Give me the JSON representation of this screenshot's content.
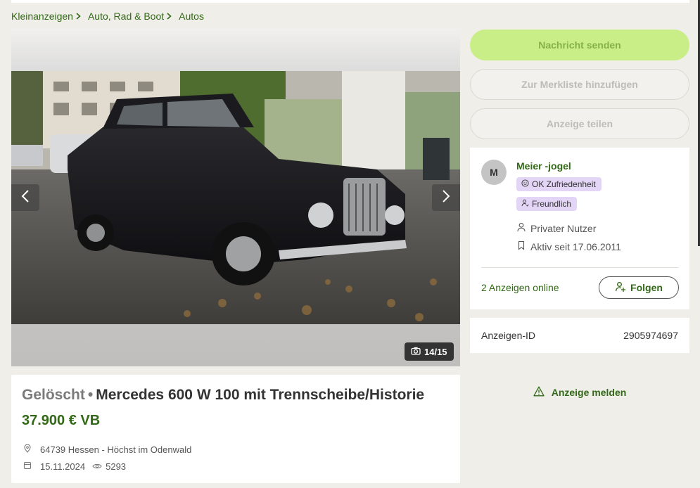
{
  "breadcrumb": {
    "items": [
      "Kleinanzeigen",
      "Auto, Rad & Boot",
      "Autos"
    ]
  },
  "gallery": {
    "counter": "14/15",
    "current_image": 14,
    "total_images": 15
  },
  "ad": {
    "status": "Gelöscht",
    "separator": "•",
    "title": "Mercedes 600 W 100 mit Trennscheibe/Historie",
    "price": "37.900 € VB",
    "location": "64739 Hessen - Höchst im Odenwald",
    "date": "15.11.2024",
    "views": "5293"
  },
  "actions": {
    "send_message": "Nachricht senden",
    "add_watchlist": "Zur Merkliste hinzufügen",
    "share": "Anzeige teilen",
    "report": "Anzeige melden"
  },
  "seller": {
    "avatar_letter": "M",
    "name": "Meier -jogel",
    "badges": [
      "OK Zufriedenheit",
      "Freundlich"
    ],
    "type": "Privater Nutzer",
    "active_since": "Aktiv seit 17.06.2011",
    "ads_online": "2 Anzeigen online",
    "follow_label": "Folgen"
  },
  "ad_id": {
    "label": "Anzeigen-ID",
    "value": "2905974697"
  },
  "colors": {
    "brand_green": "#326916",
    "primary_button": "#c9ee88",
    "badge_bg": "#e3d5f5",
    "page_bg": "#efeee9"
  },
  "icons": [
    "chevron-right-icon",
    "chevron-left-icon",
    "camera-icon",
    "location-pin-icon",
    "calendar-icon",
    "eye-icon",
    "smiley-icon",
    "friendly-icon",
    "user-icon",
    "bookmark-icon",
    "follow-user-icon",
    "warning-icon"
  ]
}
